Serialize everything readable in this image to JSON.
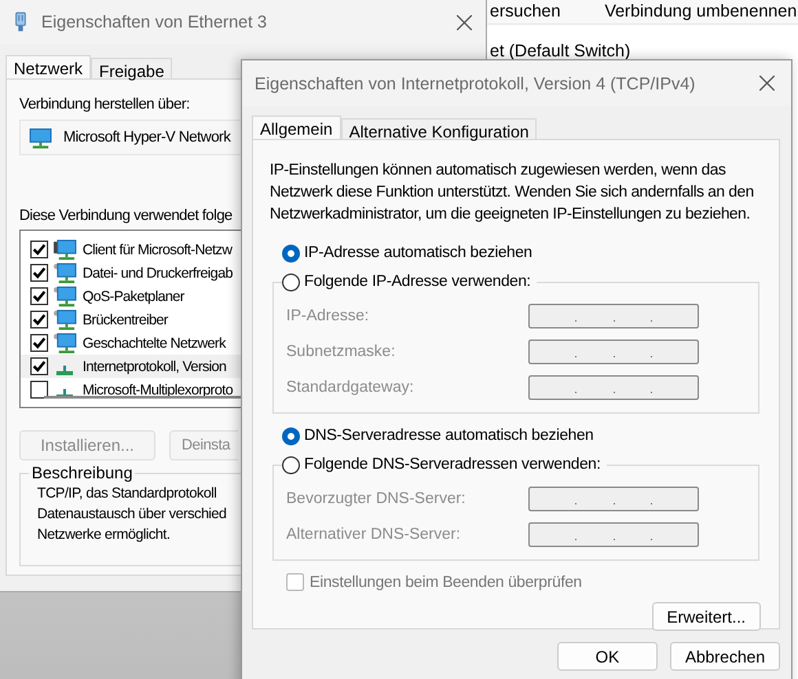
{
  "background_window": {
    "toolbar": [
      "ersuchen",
      "Verbindung umbenennen"
    ],
    "item": "et (Default Switch)"
  },
  "ethernet_dialog": {
    "title": "Eigenschaften von Ethernet 3",
    "tabs": [
      {
        "label": "Netzwerk",
        "selected": true
      },
      {
        "label": "Freigabe",
        "selected": false
      }
    ],
    "connect_label": "Verbindung herstellen über:",
    "adapter": "Microsoft Hyper-V Network",
    "components_label": "Diese Verbindung verwendet folge",
    "components": [
      {
        "label": "Client für Microsoft-Netzw",
        "checked": true,
        "selected": false,
        "kind": "client"
      },
      {
        "label": "Datei- und Druckerfreigab",
        "checked": true,
        "selected": false,
        "kind": "service"
      },
      {
        "label": "QoS-Paketplaner",
        "checked": true,
        "selected": false,
        "kind": "service"
      },
      {
        "label": "Brückentreiber",
        "checked": true,
        "selected": false,
        "kind": "service"
      },
      {
        "label": "Geschachtelte Netzwerk",
        "checked": true,
        "selected": false,
        "kind": "service"
      },
      {
        "label": "Internetprotokoll, Version",
        "checked": true,
        "selected": true,
        "kind": "protocol"
      },
      {
        "label": "Microsoft-Multiplexorproto",
        "checked": false,
        "selected": false,
        "kind": "protocol"
      }
    ],
    "buttons": [
      {
        "label": "Installieren...",
        "disabled": true
      },
      {
        "label": "Deinsta",
        "disabled": true
      }
    ],
    "description": {
      "title": "Beschreibung",
      "lines": [
        "TCP/IP, das Standardprotokoll",
        "Datenaustausch über verschied",
        "Netzwerke ermöglicht."
      ]
    }
  },
  "ipv4_dialog": {
    "title": "Eigenschaften von Internetprotokoll, Version 4 (TCP/IPv4)",
    "tabs": [
      {
        "label": "Allgemein",
        "selected": true
      },
      {
        "label": "Alternative Konfiguration",
        "selected": false
      }
    ],
    "intro": "IP-Einstellungen können automatisch zugewiesen werden, wenn das Netzwerk diese Funktion unterstützt. Wenden Sie sich andernfalls an den Netzwerkadministrator, um die geeigneten IP-Einstellungen zu beziehen.",
    "ip_options": [
      {
        "label": "IP-Adresse automatisch beziehen",
        "selected": true
      },
      {
        "label": "Folgende IP-Adresse verwenden:",
        "selected": false
      }
    ],
    "ip_fields": [
      {
        "label": "IP-Adresse:",
        "disabled": true
      },
      {
        "label": "Subnetzmaske:",
        "disabled": true
      },
      {
        "label": "Standardgateway:",
        "disabled": true
      }
    ],
    "dns_options": [
      {
        "label": "DNS-Serveradresse automatisch beziehen",
        "selected": true
      },
      {
        "label": "Folgende DNS-Serveradressen verwenden:",
        "selected": false
      }
    ],
    "dns_fields": [
      {
        "label": "Bevorzugter DNS-Server:",
        "disabled": true
      },
      {
        "label": "Alternativer DNS-Server:",
        "disabled": true
      }
    ],
    "validate": {
      "label": "Einstellungen beim Beenden überprüfen",
      "checked": false,
      "disabled": true
    },
    "advanced_button": "Erweitert...",
    "buttons": [
      "OK",
      "Abbrechen"
    ]
  }
}
